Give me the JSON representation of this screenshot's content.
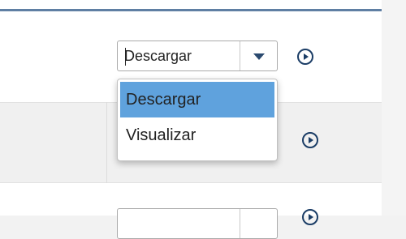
{
  "rows": [
    {
      "select": {
        "value": "Descargar",
        "open": true,
        "options": [
          {
            "label": "Descargar",
            "selected": true
          },
          {
            "label": "Visualizar",
            "selected": false
          }
        ]
      },
      "action_icon": "play-circle-icon"
    },
    {
      "action_icon": "play-circle-icon"
    },
    {
      "select": {
        "value": ""
      },
      "action_icon": "play-circle-icon"
    }
  ],
  "colors": {
    "header_border": "#5f7fa3",
    "selected_option": "#5fa2dd",
    "icon": "#1b3d66"
  }
}
